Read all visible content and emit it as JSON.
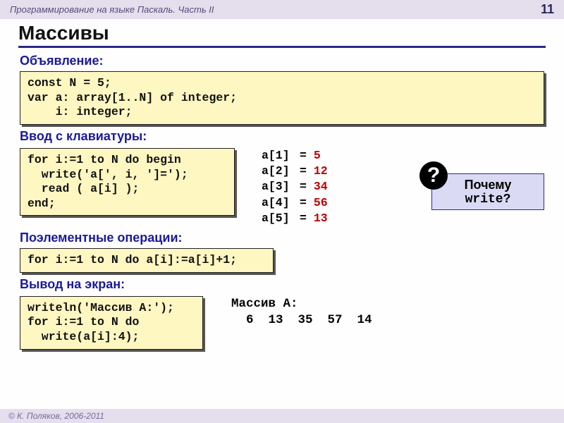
{
  "header": {
    "title": "Программирование на языке Паскаль. Часть II",
    "page": "11"
  },
  "title": "Массивы",
  "sections": {
    "decl": {
      "title": "Объявление:",
      "code": "const N = 5;\nvar a: array[1..N] of integer;\n    i: integer;"
    },
    "input": {
      "title": "Ввод с клавиатуры:",
      "code": "for i:=1 to N do begin\n  write('a[', i, ']=');\n  read ( a[i] );\nend;",
      "io": [
        {
          "lhs": "a[1]",
          "eq": "=",
          "val": "5"
        },
        {
          "lhs": "a[2]",
          "eq": "=",
          "val": "12"
        },
        {
          "lhs": "a[3]",
          "eq": "=",
          "val": "34"
        },
        {
          "lhs": "a[4]",
          "eq": "=",
          "val": "56"
        },
        {
          "lhs": "a[5]",
          "eq": "=",
          "val": "13"
        }
      ]
    },
    "ops": {
      "title": "Поэлементные операции:",
      "code": "for i:=1 to N do a[i]:=a[i]+1;"
    },
    "out": {
      "title": "Вывод на экран:",
      "code": "writeln('Массив A:');\nfor i:=1 to N do\n  write(a[i]:4);",
      "sample_label": "Массив A:",
      "sample_values": "  6  13  35  57  14"
    }
  },
  "question": {
    "mark": "?",
    "line1": "Почему",
    "line2": "write?"
  },
  "footer": "© К. Поляков, 2006-2011"
}
